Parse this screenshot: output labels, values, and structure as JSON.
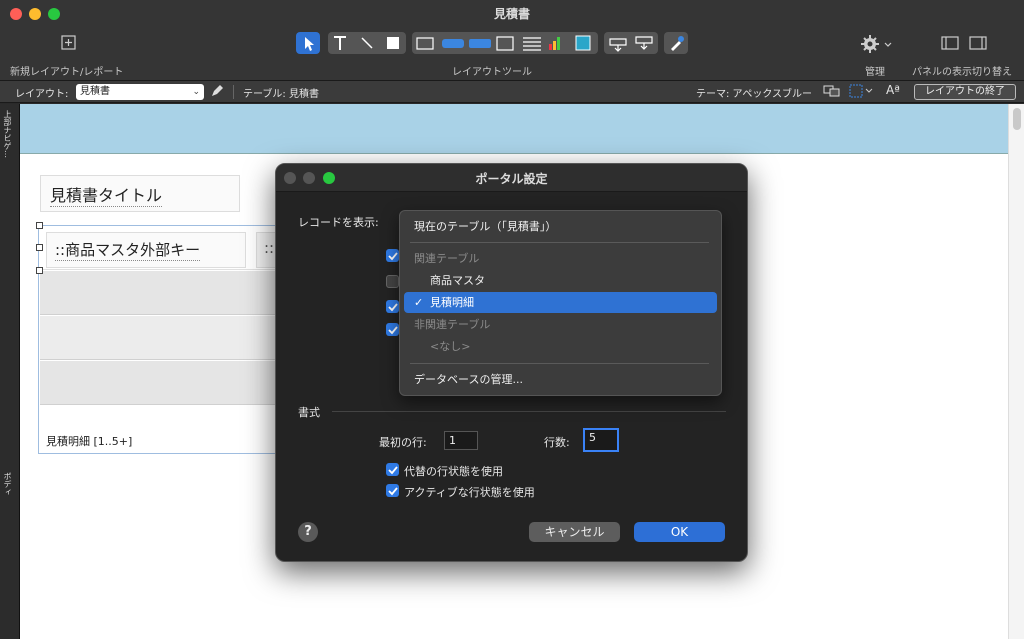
{
  "window": {
    "title": "見積書"
  },
  "toolbar": {
    "new_layout_label": "新規レイアウト/レポート",
    "layout_tools_label": "レイアウトツール",
    "manage_label": "管理",
    "panel_toggle_label": "パネルの表示切り替え"
  },
  "layoutbar": {
    "layout_label": "レイアウト:",
    "layout_value": "見積書",
    "table_label": "テーブル: 見積書",
    "theme_label": "テーマ: アペックスブルー",
    "exit_layout": "レイアウトの終了"
  },
  "parts": {
    "header": "上部ナビゲ…",
    "body": "ボディ"
  },
  "canvas": {
    "title_field": "見積書タイトル",
    "portal_field": "::商品マスタ外部キー",
    "portal_field2": "::",
    "portal_name": "見積明細 [1..5+]"
  },
  "dialog": {
    "title": "ポータル設定",
    "show_records_label": "レコードを表示:",
    "format_section": "書式",
    "first_row_label": "最初の行:",
    "first_row_value": "1",
    "rows_label": "行数:",
    "rows_value": "5",
    "alt_row_label": "代替の行状態を使用",
    "active_row_label": "アクティブな行状態を使用",
    "help": "?",
    "cancel": "キャンセル",
    "ok": "OK"
  },
  "menu": {
    "current_table": "現在のテーブル（「見積書」）",
    "related_header": "関連テーブル",
    "item_product": "商品マスタ",
    "item_selected": "見積明細",
    "unrelated_header": "非関連テーブル",
    "item_none": "<なし>",
    "manage_db": "データベースの管理..."
  },
  "colors": {
    "accent": "#2f72d3",
    "header_part": "#a9d2e7"
  }
}
